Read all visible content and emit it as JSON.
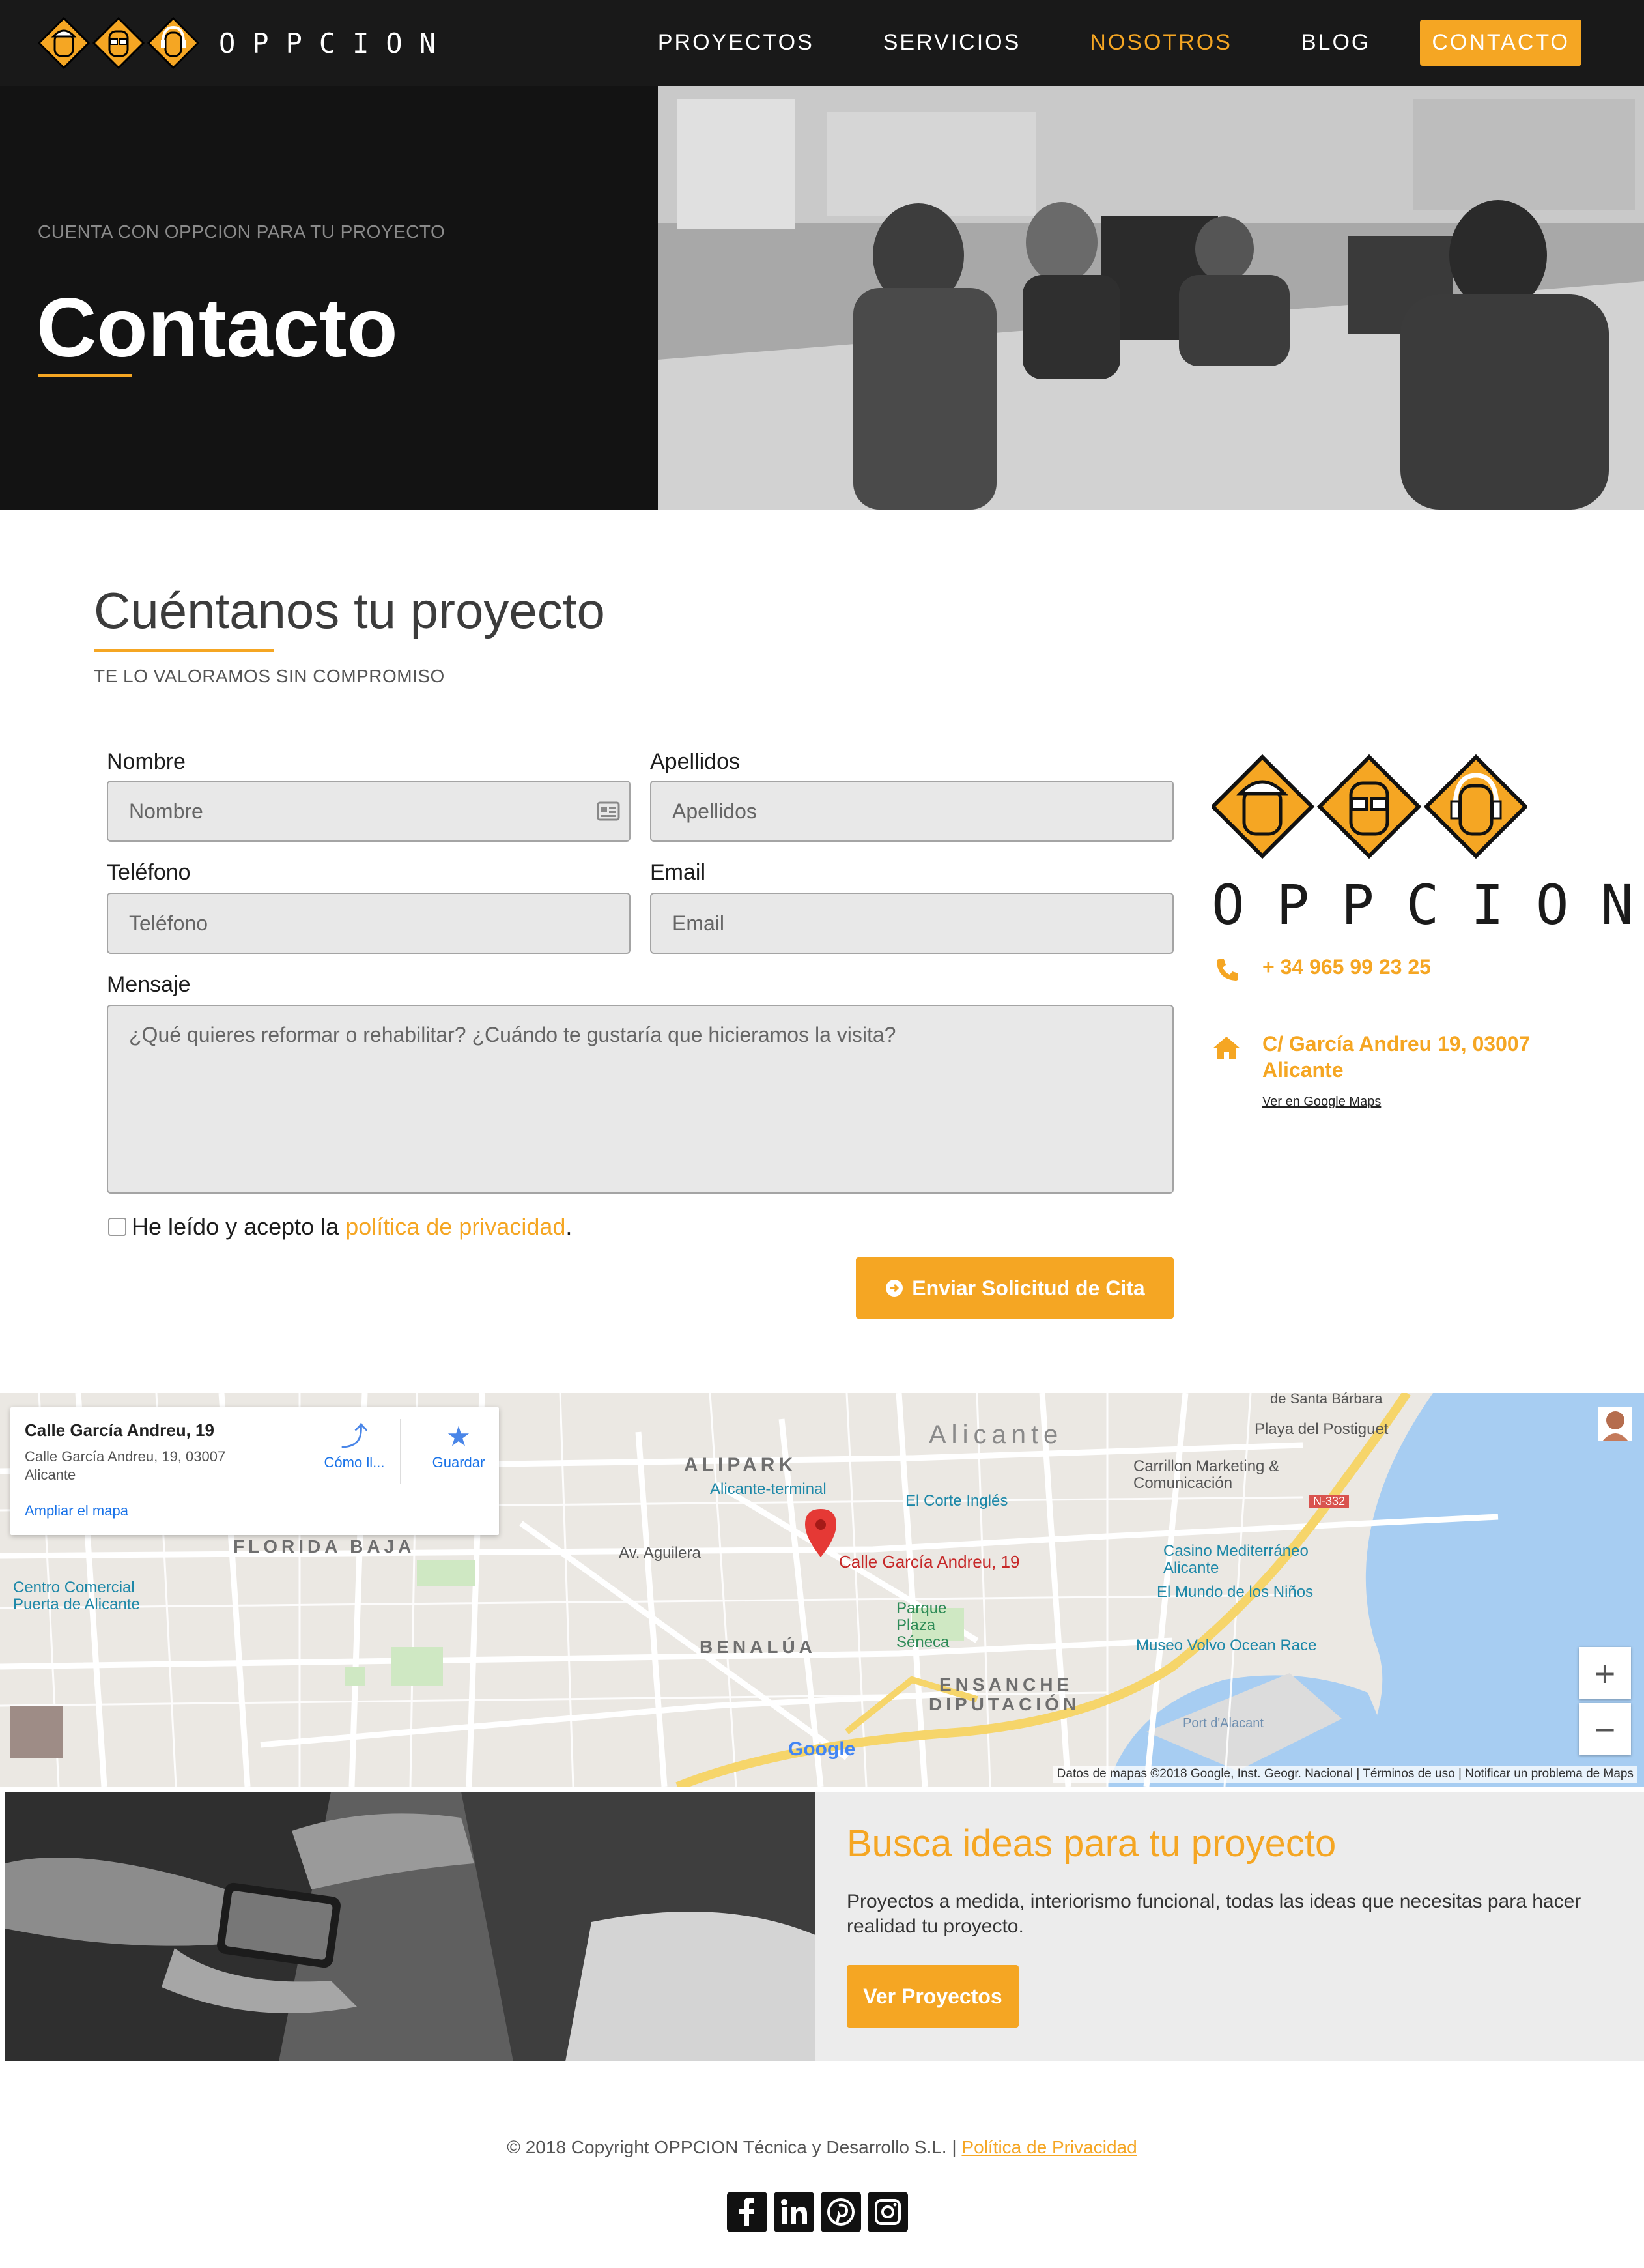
{
  "brand": {
    "name": "OPPCION",
    "accent": "#f5a623",
    "dark": "#191919"
  },
  "nav": {
    "items": [
      {
        "label": "PROYECTOS"
      },
      {
        "label": "SERVICIOS"
      },
      {
        "label": "NOSOTROS"
      },
      {
        "label": "BLOG"
      },
      {
        "label": "CONTACTO"
      }
    ],
    "active": "NOSOTROS",
    "cta": "CONTACTO"
  },
  "hero": {
    "eyebrow": "CUENTA CON OPPCION PARA TU PROYECTO",
    "title": "Contacto"
  },
  "form": {
    "title": "Cuéntanos tu proyecto",
    "subtitle": "TE LO VALORAMOS SIN COMPROMISO",
    "nombre": {
      "label": "Nombre",
      "placeholder": "Nombre"
    },
    "apellidos": {
      "label": "Apellidos",
      "placeholder": "Apellidos"
    },
    "telefono": {
      "label": "Teléfono",
      "placeholder": "Teléfono"
    },
    "email": {
      "label": "Email",
      "placeholder": "Email"
    },
    "mensaje": {
      "label": "Mensaje",
      "placeholder": "¿Qué quieres reformar o rehabilitar? ¿Cuándo te gustaría que hicieramos la visita?"
    },
    "privacy": {
      "prefix": "He leído y acepto la ",
      "link": "política de privacidad",
      "suffix": "."
    },
    "submit": "Enviar Solicitud de Cita"
  },
  "contact": {
    "phone": "+ 34 965 99 23 25",
    "address_line1": "C/ García Andreu 19, 03007",
    "address_line2": "Alicante",
    "maps_link": "Ver en Google Maps"
  },
  "map": {
    "card_title": "Calle García Andreu, 19",
    "card_address": "Calle García Andreu, 19, 03007 Alicante",
    "expand": "Ampliar el mapa",
    "directions": "Cómo ll...",
    "save": "Guardar",
    "zoom_in": "+",
    "zoom_out": "−",
    "attribution": "Datos de mapas ©2018 Google, Inst. Geogr. Nacional  |  Términos de uso  |  Notificar un problema de Maps",
    "google": "Google",
    "labels": {
      "alicante": "Alicante",
      "alipark": "ALIPARK",
      "terminal": "Alicante-terminal",
      "corte": "El Corte Inglés",
      "florida": "FLORIDA BAJA",
      "benalua": "BENALÚA",
      "ensanche": "ENSANCHE",
      "diputacion": "DIPUTACIÓN",
      "marker": "Calle García Andreu, 19",
      "postiguet": "Playa del Postiguet",
      "casino": "Casino Mediterráneo Alicante",
      "ninos": "El Mundo de los Niños",
      "volvo": "Museo Volvo Ocean Race",
      "parque": "Parque Plaza Séneca",
      "centro": "Centro Comercial Puerta de Alicante",
      "carrillon": "Carrillon Marketing & Comunicación",
      "aguilera": "Av. Aguilera",
      "santa": "de Santa Bárbara",
      "port": "Port d'Alacant",
      "n332": "N-332"
    }
  },
  "promo": {
    "title": "Busca ideas para tu proyecto",
    "text": "Proyectos a medida, interiorismo funcional, todas las ideas que necesitas para hacer realidad tu proyecto.",
    "button": "Ver Proyectos"
  },
  "footer": {
    "copyright": "© 2018 Copyright OPPCION Técnica y Desarrollo S.L. | ",
    "privacy": "Política de Privacidad",
    "socials": [
      "facebook-icon",
      "linkedin-icon",
      "pinterest-icon",
      "instagram-icon"
    ]
  }
}
